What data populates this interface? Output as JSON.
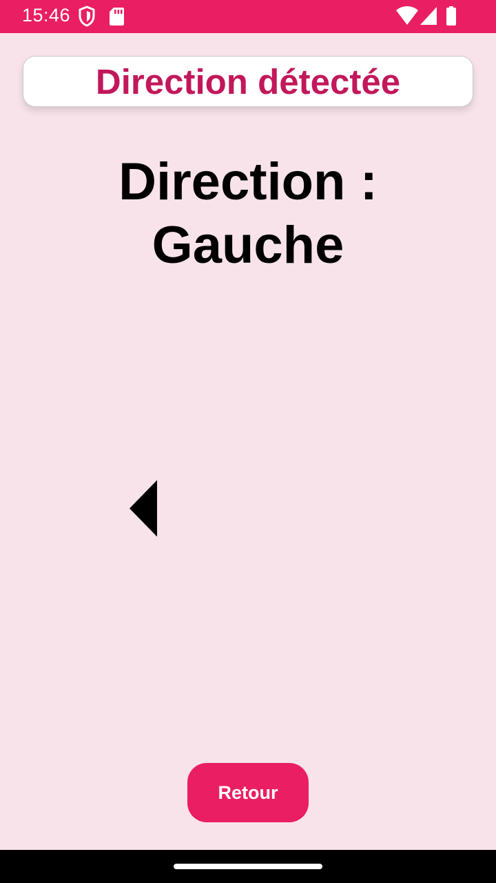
{
  "status_bar": {
    "time": "15:46",
    "icons": [
      "vpn-shield-icon",
      "sd-card-icon",
      "wifi-icon",
      "cellular-signal-icon",
      "battery-icon"
    ],
    "background_color": "#e91e63"
  },
  "header": {
    "title": "Direction détectée",
    "title_color": "#c2185b"
  },
  "main": {
    "direction_label": "Direction : Gauche",
    "arrow_icon": "arrow-left-icon"
  },
  "footer": {
    "back_label": "Retour",
    "button_color": "#e91e63"
  },
  "page": {
    "background_color": "#f8e3ea"
  }
}
